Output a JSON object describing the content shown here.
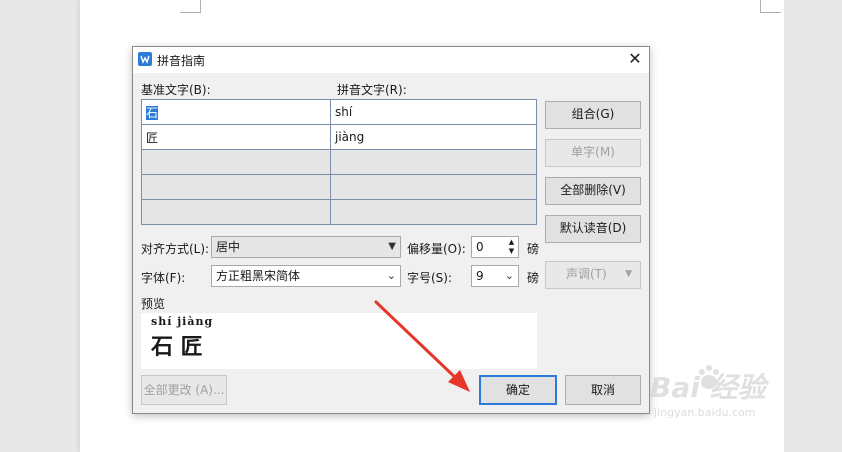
{
  "dialog": {
    "title": "拼音指南",
    "base_text_label": "基准文字(B):",
    "ruby_text_label": "拼音文字(R):",
    "rows": [
      {
        "base": "石",
        "ruby": "shí"
      },
      {
        "base": "匠",
        "ruby": "jiàng"
      },
      {
        "base": "",
        "ruby": ""
      },
      {
        "base": "",
        "ruby": ""
      },
      {
        "base": "",
        "ruby": ""
      }
    ],
    "buttons": {
      "group": "组合(G)",
      "mono": "单字(M)",
      "clear_all": "全部删除(V)",
      "default_reading": "默认读音(D)",
      "tone": "声调(T)",
      "apply_all": "全部更改 (A)...",
      "ok": "确定",
      "cancel": "取消"
    },
    "alignment": {
      "label": "对齐方式(L):",
      "value": "居中"
    },
    "offset": {
      "label": "偏移量(O):",
      "value": "0",
      "unit": "磅"
    },
    "font": {
      "label": "字体(F):",
      "value": "方正粗黑宋简体"
    },
    "size": {
      "label": "字号(S):",
      "value": "9",
      "unit": "磅"
    },
    "preview": {
      "label": "预览",
      "ruby_line": "shí jiàng",
      "base_line": "石 匠"
    }
  },
  "watermark": {
    "brand": "Bai  经验",
    "url": "jingyan.baidu.com"
  },
  "colors": {
    "accent": "#2b7bd8",
    "arrow": "#e8352a"
  }
}
